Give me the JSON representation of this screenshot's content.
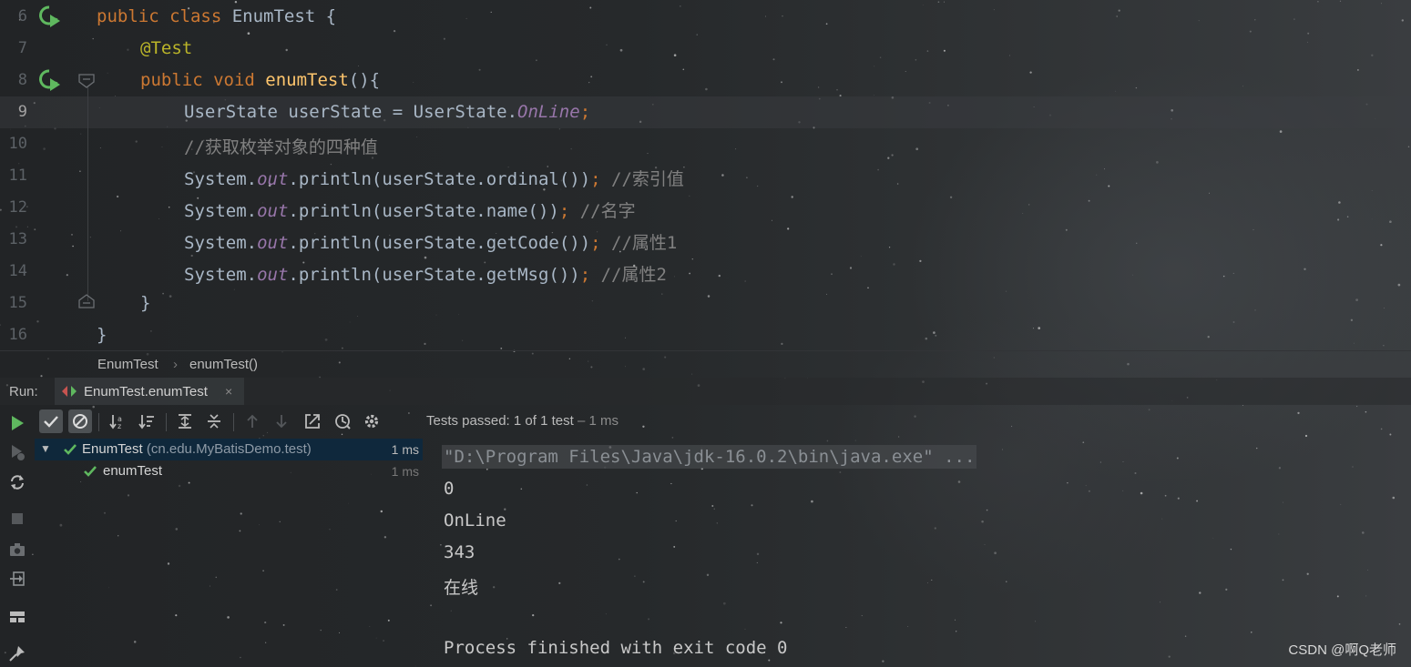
{
  "editor": {
    "lines": [
      {
        "num": "6",
        "html_parts": [
          [
            "kw",
            "public class "
          ],
          [
            "",
            "EnumTest {"
          ]
        ]
      },
      {
        "num": "7",
        "html_parts": [
          [
            "ann",
            "@Test"
          ]
        ]
      },
      {
        "num": "8",
        "html_parts": [
          [
            "kw",
            "public void "
          ],
          [
            "fn",
            "enumTest"
          ],
          [
            "",
            "(){"
          ]
        ]
      },
      {
        "num": "9",
        "html_parts": [
          [
            "",
            "UserState userState = UserState."
          ],
          [
            "st",
            "OnLine"
          ],
          [
            "kw",
            ";"
          ]
        ]
      },
      {
        "num": "10",
        "html_parts": [
          [
            "cm",
            "//获取枚举对象的四种值"
          ]
        ]
      },
      {
        "num": "11",
        "html_parts": [
          [
            "",
            "System."
          ],
          [
            "st",
            "out"
          ],
          [
            "",
            ".println(userState.ordinal())"
          ],
          [
            "kw",
            "; "
          ],
          [
            "cm",
            "//索引值"
          ]
        ]
      },
      {
        "num": "12",
        "html_parts": [
          [
            "",
            "System."
          ],
          [
            "st",
            "out"
          ],
          [
            "",
            ".println(userState.name())"
          ],
          [
            "kw",
            "; "
          ],
          [
            "cm",
            "//名字"
          ]
        ]
      },
      {
        "num": "13",
        "html_parts": [
          [
            "",
            "System."
          ],
          [
            "st",
            "out"
          ],
          [
            "",
            ".println(userState.getCode())"
          ],
          [
            "kw",
            "; "
          ],
          [
            "cm",
            "//属性1"
          ]
        ]
      },
      {
        "num": "14",
        "html_parts": [
          [
            "",
            "System."
          ],
          [
            "st",
            "out"
          ],
          [
            "",
            ".println(userState.getMsg())"
          ],
          [
            "kw",
            "; "
          ],
          [
            "cm",
            "//属性2"
          ]
        ]
      },
      {
        "num": "15",
        "html_parts": [
          [
            "",
            "}"
          ]
        ]
      },
      {
        "num": "16",
        "html_parts": [
          [
            "",
            "}"
          ]
        ]
      }
    ],
    "current_line": "9"
  },
  "breadcrumb": {
    "class_name": "EnumTest",
    "separator": "›",
    "method_name": "enumTest()"
  },
  "run_panel": {
    "label": "Run:",
    "tab_label": "EnumTest.enumTest",
    "tab_close": "×",
    "status_prefix": "Tests passed: ",
    "status_count": "1",
    "status_suffix": " of 1 test",
    "status_time": " – 1 ms"
  },
  "test_tree": {
    "root": {
      "name": "EnumTest",
      "package": " (cn.edu.MyBatisDemo.test)",
      "time": "1 ms"
    },
    "child": {
      "name": "enumTest",
      "time": "1 ms"
    }
  },
  "console": {
    "command": "\"D:\\Program Files\\Java\\jdk-16.0.2\\bin\\java.exe\" ...",
    "outputs": [
      "0",
      "OnLine",
      "343",
      "在线"
    ],
    "exit_message": "Process finished with exit code 0"
  },
  "watermark": "CSDN @啊Q老师",
  "colors": {
    "keyword": "#cc7832",
    "annotation": "#bbb529",
    "method": "#ffc66d",
    "static_field": "#9876aa",
    "comment": "#808080",
    "pass_green": "#5fb85f",
    "selection": "#0d293e"
  },
  "icons": {
    "run_gutter": "run-test-gutter-icon",
    "toolbar": [
      "show-passed-icon",
      "show-ignored-icon",
      "sort-alpha-icon",
      "sort-duration-icon",
      "expand-all-icon",
      "collapse-all-icon",
      "prev-failed-icon",
      "next-failed-icon",
      "export-icon",
      "history-icon",
      "settings-icon"
    ],
    "side": [
      "rerun-icon",
      "rerun-failed-icon",
      "toggle-auto-test-icon",
      "stop-icon",
      "snapshot-icon",
      "exit-icon",
      "layout-icon",
      "pin-icon"
    ]
  }
}
